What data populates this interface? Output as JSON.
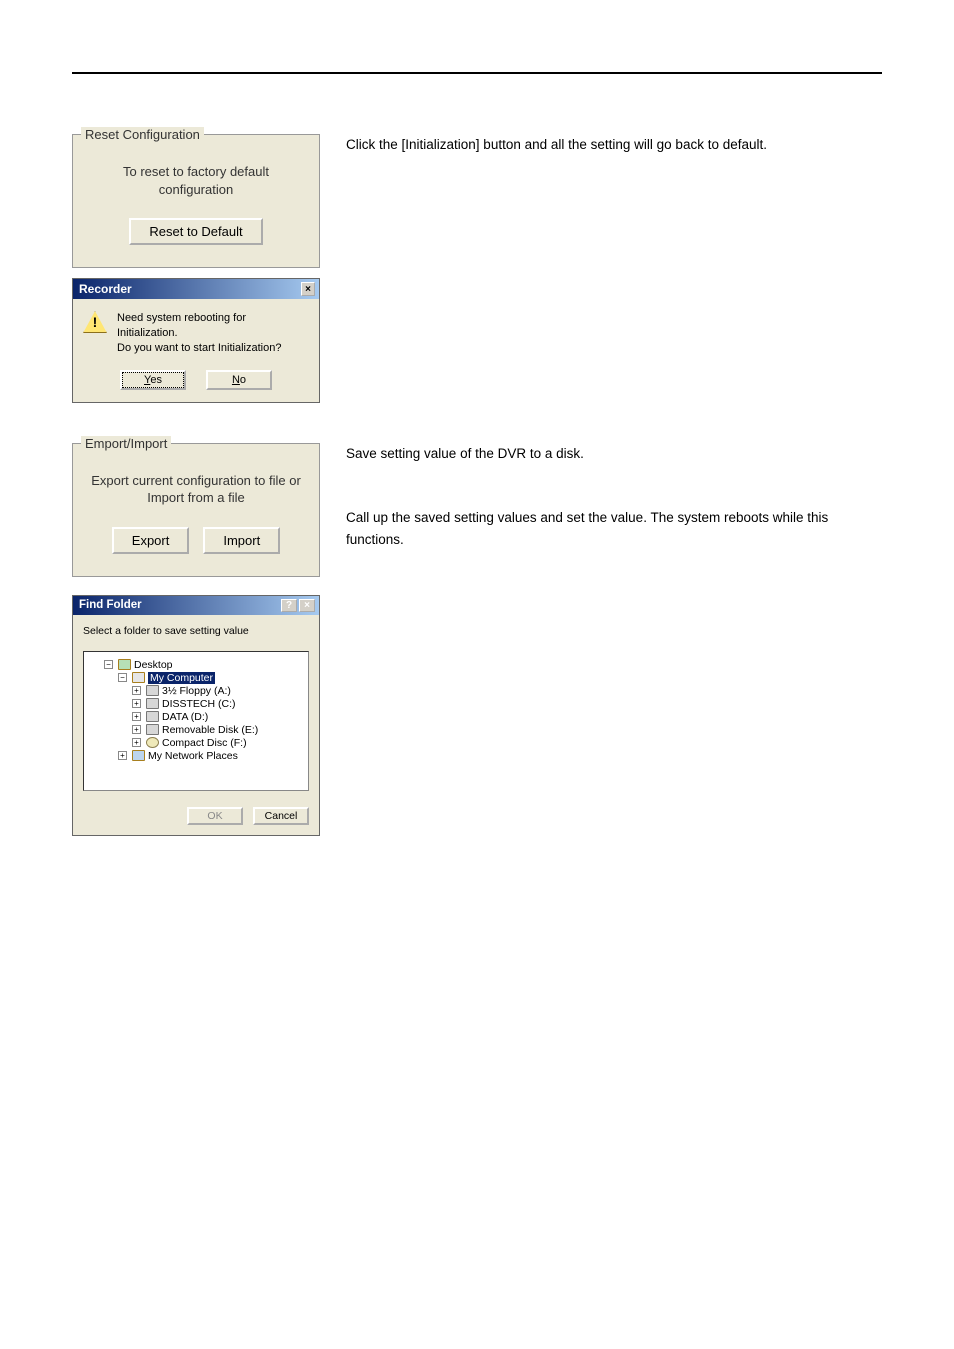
{
  "reset_section": {
    "group_title": "Reset Configuration",
    "group_text": "To reset to factory default configuration",
    "reset_button": "Reset to Default",
    "desc": "Click the [Initialization] button and all the setting will go back to default."
  },
  "recorder_msgbox": {
    "title": "Recorder",
    "line1": "Need system rebooting for Initialization.",
    "line2": "Do you want to start Initialization?",
    "yes": "Yes",
    "no": "No"
  },
  "export_section": {
    "group_title": "Emport/Import",
    "group_text": "Export current configuration to file or Import from a file",
    "export_btn": "Export",
    "import_btn": "Import",
    "desc1": "Save setting value of the DVR to a disk.",
    "desc2": "Call up the saved setting values and set the value. The system reboots while this functions."
  },
  "find_folder": {
    "title": "Find Folder",
    "prompt": "Select a folder to save setting value",
    "ok": "OK",
    "cancel": "Cancel",
    "tree": {
      "desktop": "Desktop",
      "my_computer": "My Computer",
      "floppy": "3½ Floppy (A:)",
      "disstech": "DISSTECH (C:)",
      "data": "DATA (D:)",
      "removable": "Removable Disk (E:)",
      "cd": "Compact Disc (F:)",
      "network": "My Network Places"
    }
  }
}
